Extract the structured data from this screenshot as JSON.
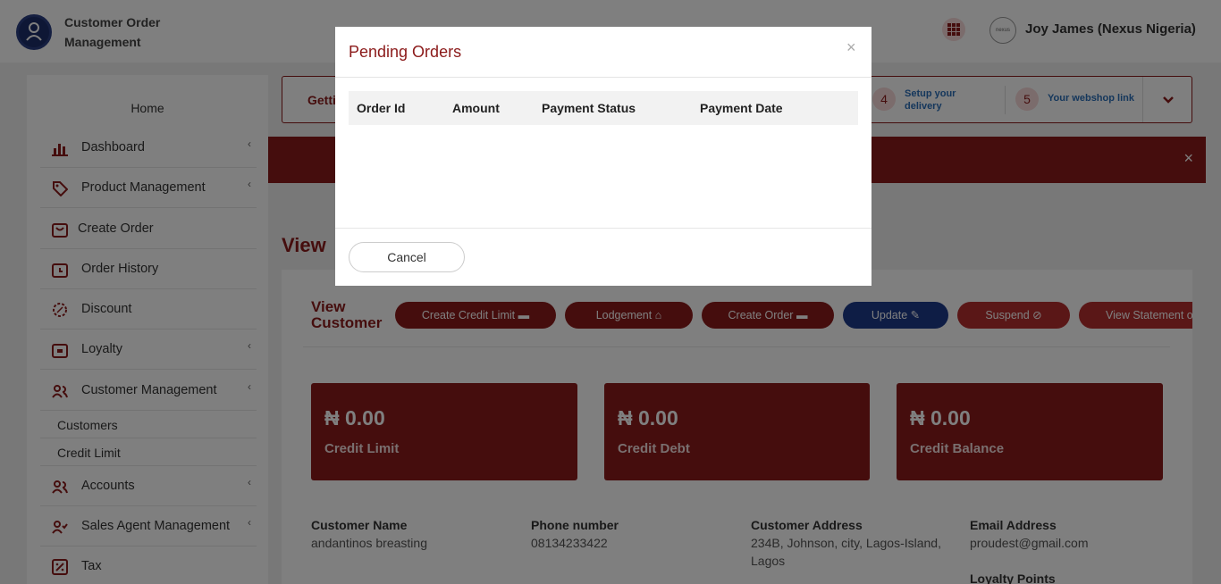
{
  "header": {
    "app_title_line1": "Customer Order",
    "app_title_line2": "Management",
    "user_name": "Joy James (Nexus Nigeria)",
    "avatar_text": "nexus"
  },
  "sidebar": {
    "home": "Home",
    "items": [
      {
        "label": "Dashboard",
        "icon": "bar-chart-icon",
        "has_submenu": true
      },
      {
        "label": "Product Management",
        "icon": "tag-icon",
        "has_submenu": true
      },
      {
        "label": "Create Order",
        "icon": "cart-icon",
        "has_submenu": false
      },
      {
        "label": "Order History",
        "icon": "history-icon",
        "has_submenu": false
      },
      {
        "label": "Discount",
        "icon": "discount-icon",
        "has_submenu": false
      },
      {
        "label": "Loyalty",
        "icon": "gift-icon",
        "has_submenu": true
      },
      {
        "label": "Customer Management",
        "icon": "users-icon",
        "has_submenu": true
      },
      {
        "label": "Accounts",
        "icon": "users-icon",
        "has_submenu": true
      },
      {
        "label": "Sales Agent Management",
        "icon": "user-check-icon",
        "has_submenu": true
      },
      {
        "label": "Tax",
        "icon": "percent-icon",
        "has_submenu": false
      }
    ],
    "subitems": [
      "Customers",
      "Credit Limit"
    ],
    "chevron": "‹"
  },
  "steps": {
    "title": "Getti",
    "items": [
      {
        "num": "4",
        "line1": "Setup your",
        "line2": "delivery"
      },
      {
        "num": "5",
        "line1": "Your webshop link",
        "line2": ""
      }
    ]
  },
  "alert": {
    "close": "×"
  },
  "page_heading": "View",
  "customer": {
    "title_line1": "View",
    "title_line2": "Customer",
    "actions": [
      {
        "label": "Create Credit Limit",
        "icon": "cart-icon",
        "color": "#8b1a1a"
      },
      {
        "label": "Lodgement",
        "icon": "bank-icon",
        "color": "#8b1a1a"
      },
      {
        "label": "Create Order",
        "icon": "cart-icon",
        "color": "#8b1a1a"
      },
      {
        "label": "Update",
        "icon": "edit-icon",
        "color": "#1d3a8a"
      },
      {
        "label": "Suspend",
        "icon": "ban-icon",
        "color": "#b52e2e"
      },
      {
        "label": "View Statement of Ac",
        "icon": "",
        "color": "#b52e2e"
      }
    ],
    "stats": [
      {
        "value": "₦ 0.00",
        "label": "Credit Limit"
      },
      {
        "value": "₦ 0.00",
        "label": "Credit Debt"
      },
      {
        "value": "₦ 0.00",
        "label": "Credit Balance"
      }
    ],
    "info": {
      "name_label": "Customer Name",
      "name_value": "andantinos breasting",
      "phone_label": "Phone number",
      "phone_value": "08134233422",
      "address_label": "Customer Address",
      "address_line1": "234B, Johnson, city, Lagos-Island,",
      "address_line2": "Lagos",
      "email_label": "Email Address",
      "email_value": "proudest@gmail.com",
      "loyalty_label": "Loyalty Points"
    }
  },
  "modal": {
    "title": "Pending Orders",
    "close": "×",
    "columns": [
      "Order Id",
      "Amount",
      "Payment Status",
      "Payment Date"
    ],
    "rows": [],
    "cancel_label": "Cancel"
  },
  "colors": {
    "brand": "#8b1a1a",
    "update_button": "#1d3a8a",
    "suspend_button": "#b52e2e",
    "steps_link": "#2a6eb8"
  }
}
